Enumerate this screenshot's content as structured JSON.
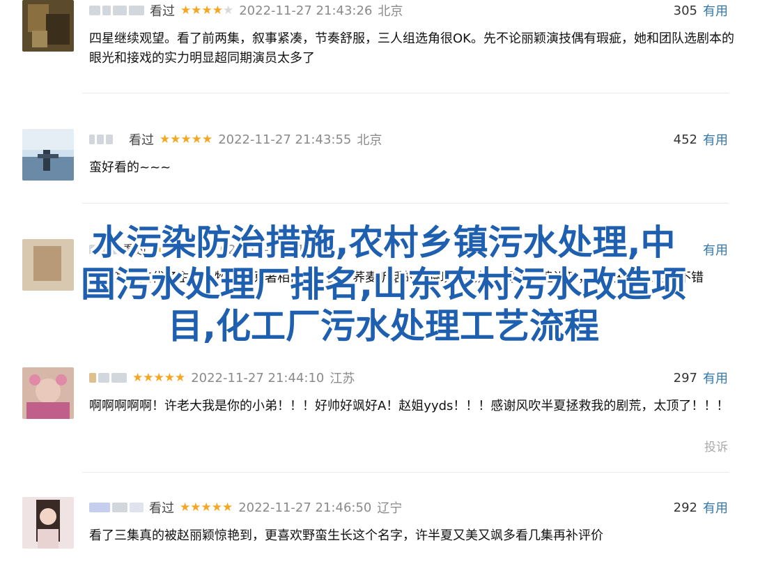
{
  "reviews": [
    {
      "watched": "看过",
      "stars": "★★★★",
      "stars_off": "★",
      "time": "2022-11-27 21:43:26",
      "location": "北京",
      "votes": "305",
      "useful": "有用",
      "text": "四星继续观望。看了前两集，叙事紧凑，节奏舒服，三人组选角很OK。先不论丽颖演技偶有瑕疵，她和团队选剧本的眼光和接戏的实力明显超同期演员太多了"
    },
    {
      "watched": "看过",
      "stars": "★★★★★",
      "stars_off": "",
      "time": "2022-11-27 21:43:55",
      "location": "北京",
      "votes": "452",
      "useful": "有用",
      "text": "蛮好看的~~~"
    },
    {
      "watched": "看过",
      "stars": "★★★★",
      "stars_off": "★",
      "time": "2022-11-27 21:4",
      "location": "",
      "votes": "",
      "useful": "有用",
      "text": "两集基本交代了主要人物，与原著相似许半夏，荞麦听话的童晓琪，老好厂猾的伍建设等，都颇有印象的很不错"
    },
    {
      "watched": "",
      "stars": "★★★★★",
      "stars_off": "",
      "time": "2022-11-27 21:44:10",
      "location": "江苏",
      "votes": "297",
      "useful": "有用",
      "text": "啊啊啊啊啊！许老大我是你的小弟！！！好帅好飒好A！赵姐yyds！！！感谢风吹半夏拯救我的剧荒，太顶了！！！",
      "report": "投诉"
    },
    {
      "watched": "看过",
      "stars": "★★★★★",
      "stars_off": "",
      "time": "2022-11-27 21:46:50",
      "location": "辽宁",
      "votes": "292",
      "useful": "有用",
      "text": "看了三集真的被赵丽颖惊艳到，更喜欢野蛮生长这个名字，许半夏又美又飒多看几集再补评价"
    }
  ],
  "overlay": {
    "line1": "水污染防治措施,农村乡镇污水处理,中",
    "line2": "国污水处理厂排名,山东农村污水改造项",
    "line3": "目,化工厂污水处理工艺流程"
  },
  "colors": {
    "accent": "#3377aa",
    "star": "#f5a623",
    "overlay": "#1f5fb0"
  }
}
